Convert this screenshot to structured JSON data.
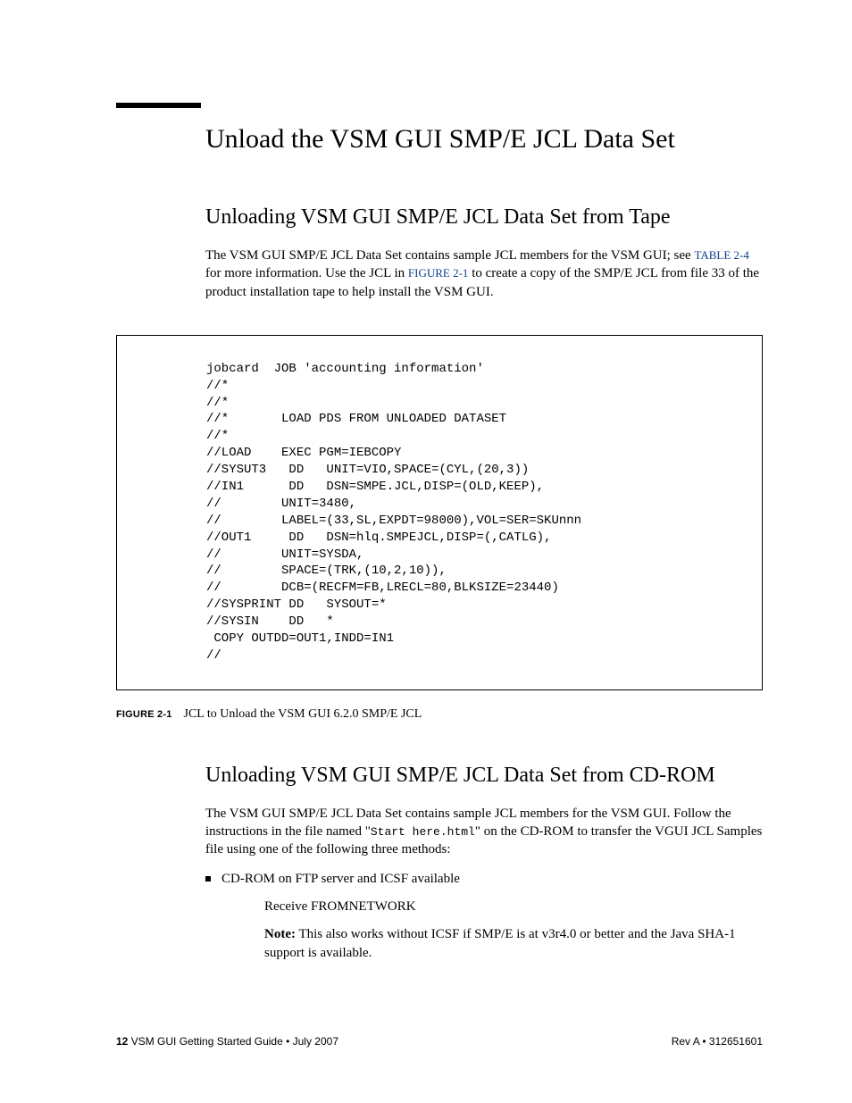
{
  "title": "Unload the VSM GUI SMP/E JCL Data Set",
  "section1": {
    "heading": "Unloading VSM GUI SMP/E JCL Data Set from Tape",
    "para_part1": "The VSM GUI SMP/E JCL Data Set contains sample JCL members for the VSM GUI; see ",
    "xref1": "TABLE 2-4",
    "para_part2": " for more information. Use the JCL in ",
    "xref2": "FIGURE 2-1",
    "para_part3": " to create a copy of the SMP/E JCL from file 33 of the product installation tape to help install the VSM GUI."
  },
  "codeblock": "jobcard  JOB 'accounting information'\n//*\n//*\n//*       LOAD PDS FROM UNLOADED DATASET\n//*\n//LOAD    EXEC PGM=IEBCOPY\n//SYSUT3   DD   UNIT=VIO,SPACE=(CYL,(20,3))\n//IN1      DD   DSN=SMPE.JCL,DISP=(OLD,KEEP),\n//        UNIT=3480,\n//        LABEL=(33,SL,EXPDT=98000),VOL=SER=SKUnnn\n//OUT1     DD   DSN=hlq.SMPEJCL,DISP=(,CATLG),\n//        UNIT=SYSDA,\n//        SPACE=(TRK,(10,2,10)),\n//        DCB=(RECFM=FB,LRECL=80,BLKSIZE=23440)\n//SYSPRINT DD   SYSOUT=*\n//SYSIN    DD   *\n COPY OUTDD=OUT1,INDD=IN1\n//",
  "figure": {
    "label": "FIGURE 2-1",
    "text": "JCL to Unload the VSM GUI 6.2.0 SMP/E JCL"
  },
  "section2": {
    "heading": "Unloading VSM GUI SMP/E JCL Data Set from CD-ROM",
    "para_part1": "The VSM GUI SMP/E JCL Data Set contains sample JCL members for the VSM GUI. Follow the instructions in the file named \"",
    "code1": "Start here.html",
    "para_part2": "\" on the CD-ROM to transfer the VGUI JCL Samples file using one of the following three methods:",
    "bullet1": "CD-ROM on FTP server and ICSF available",
    "sub1": "Receive FROMNETWORK",
    "note_label": "Note:",
    "note_text": " This also works without ICSF if SMP/E is at v3r4.0 or better and the Java SHA-1 support is available."
  },
  "footer": {
    "page": "12",
    "left": "  VSM GUI Getting Started Guide  •  July 2007",
    "right": "Rev A  •  312651601"
  }
}
